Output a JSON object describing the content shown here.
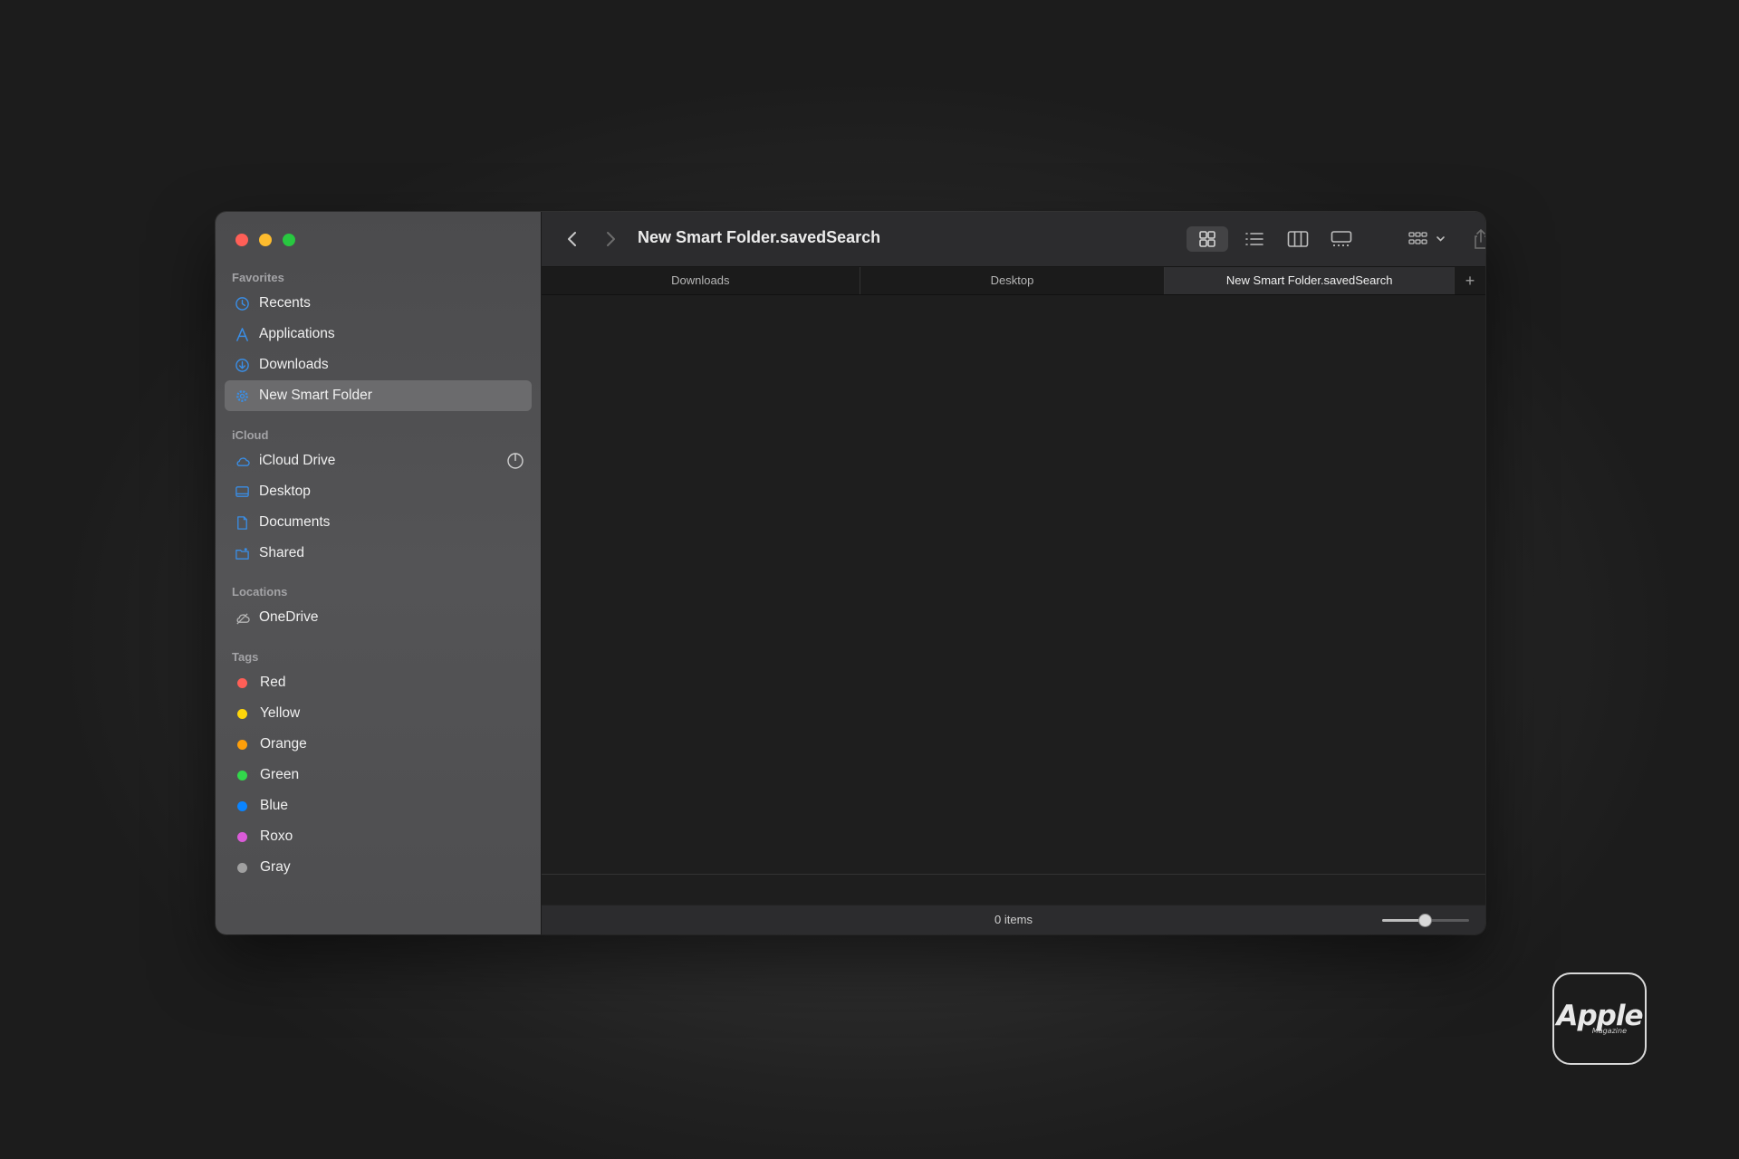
{
  "window": {
    "title": "New Smart Folder.savedSearch"
  },
  "sidebar": {
    "favorites": {
      "heading": "Favorites",
      "items": [
        {
          "label": "Recents",
          "icon": "clock-icon"
        },
        {
          "label": "Applications",
          "icon": "applications-icon"
        },
        {
          "label": "Downloads",
          "icon": "download-icon"
        },
        {
          "label": "New Smart Folder",
          "icon": "gear-icon",
          "selected": true
        }
      ]
    },
    "icloud": {
      "heading": "iCloud",
      "items": [
        {
          "label": "iCloud Drive",
          "icon": "cloud-icon"
        },
        {
          "label": "Desktop",
          "icon": "desktop-icon"
        },
        {
          "label": "Documents",
          "icon": "document-icon"
        },
        {
          "label": "Shared",
          "icon": "shared-folder-icon"
        }
      ]
    },
    "locations": {
      "heading": "Locations",
      "items": [
        {
          "label": "OneDrive",
          "icon": "cloud-slash-icon"
        }
      ]
    },
    "tags": {
      "heading": "Tags",
      "items": [
        {
          "label": "Red",
          "color": "#ff5f57"
        },
        {
          "label": "Yellow",
          "color": "#ffd60a"
        },
        {
          "label": "Orange",
          "color": "#ff9f0a"
        },
        {
          "label": "Green",
          "color": "#32d74b"
        },
        {
          "label": "Blue",
          "color": "#0a84ff"
        },
        {
          "label": "Roxo",
          "color": "#da5bd8"
        },
        {
          "label": "Gray",
          "color": "#a0a0a0"
        }
      ]
    }
  },
  "tabs": [
    {
      "label": "Downloads",
      "active": false
    },
    {
      "label": "Desktop",
      "active": false
    },
    {
      "label": "New Smart Folder.savedSearch",
      "active": true
    }
  ],
  "tab_add_label": "+",
  "status": {
    "items_text": "0 items",
    "icon_size_level": 0.5
  },
  "watermark": {
    "word": "Apple",
    "sub": "Magazine"
  }
}
